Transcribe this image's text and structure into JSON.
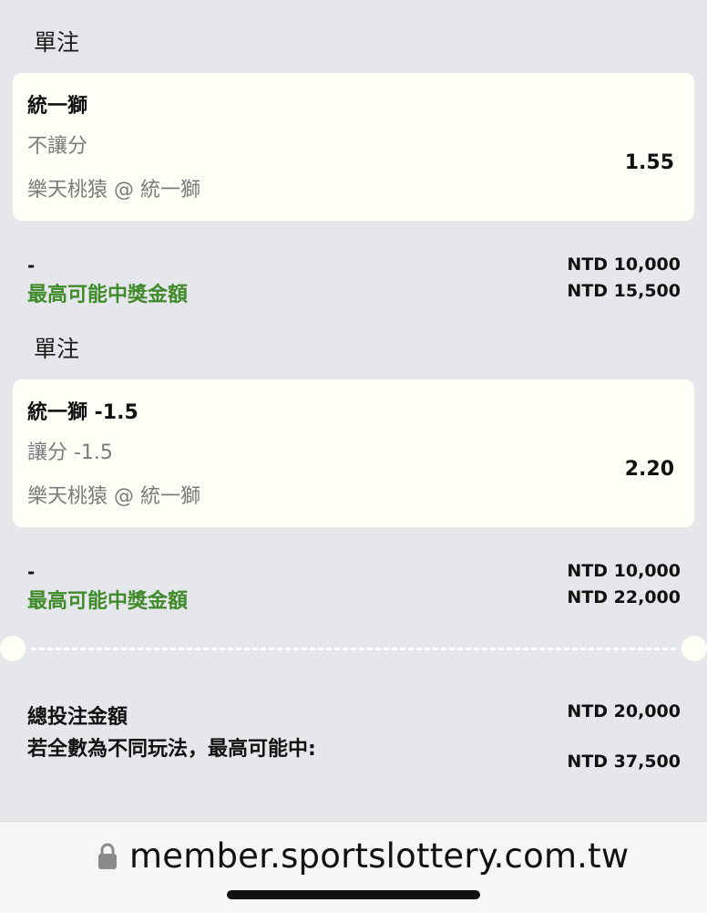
{
  "bets": [
    {
      "section_title": "單注",
      "team": "統一獅",
      "market": "不讓分",
      "match": "樂天桃猿 @ 統一獅",
      "odds": "1.55",
      "dash": "-",
      "max_label": "最高可能中獎金額",
      "stake": "NTD 10,000",
      "max_win": "NTD 15,500"
    },
    {
      "section_title": "單注",
      "team": "統一獅 -1.5",
      "market": "讓分 -1.5",
      "match": "樂天桃猿 @ 統一獅",
      "odds": "2.20",
      "dash": "-",
      "max_label": "最高可能中獎金額",
      "stake": "NTD 10,000",
      "max_win": "NTD 22,000"
    }
  ],
  "totals": {
    "total_stake_label": "總投注金額",
    "total_stake": "NTD 20,000",
    "max_possible_label": "若全數為不同玩法，最高可能中:",
    "max_possible": "NTD 37,500"
  },
  "browser": {
    "url": "member.sportslottery.com.tw",
    "lock_icon": "lock-icon"
  },
  "colors": {
    "background": "#e6e7eb",
    "card": "#fffff8",
    "accent_green": "#3f8a2a",
    "muted_text": "#7b7b7b"
  }
}
